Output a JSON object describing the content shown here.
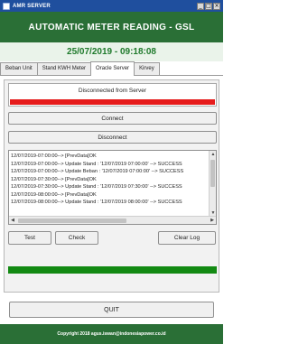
{
  "window": {
    "title": "AMR SERVER",
    "controls": [
      "_",
      "□",
      "×"
    ]
  },
  "header": {
    "title": "AUTOMATIC METER READING - GSL",
    "datetime": "25/07/2019 - 09:18:08"
  },
  "tabs": [
    {
      "label": "Beban Unit",
      "active": false
    },
    {
      "label": "Stand KWH Meter",
      "active": false
    },
    {
      "label": "Oracle Server",
      "active": true
    },
    {
      "label": "Kirvey",
      "active": false
    }
  ],
  "oracle": {
    "status": "Disconnected from Server",
    "status_color": "#e61b1b",
    "connect_label": "Connect",
    "disconnect_label": "Disconnect",
    "log_lines": [
      "12/07/2019-07:00:00--> [PrevData]OK",
      "12/07/2019-07:00:00--> Update Stand : '12/07/2019 07:00:00' --> SUCCESS",
      "12/07/2019-07:00:00--> Update Beban : '12/07/2019 07:00:00' --> SUCCESS",
      "12/07/2019-07:30:00--> [PrevData]OK",
      "12/07/2019-07:30:00--> Update Stand : '12/07/2019 07:30:00' --> SUCCESS",
      "12/07/2019-08:00:00--> [PrevData]OK",
      "12/07/2019-08:00:00--> Update Stand : '12/07/2019 08:00:00' --> SUCCESS"
    ],
    "test_label": "Test",
    "check_label": "Check",
    "clearlog_label": "Clear Log",
    "indicator_color": "#138a13"
  },
  "quit_label": "QUIT",
  "footer": "Copyright 2018 agus.iswan@indonesiapower.co.id"
}
